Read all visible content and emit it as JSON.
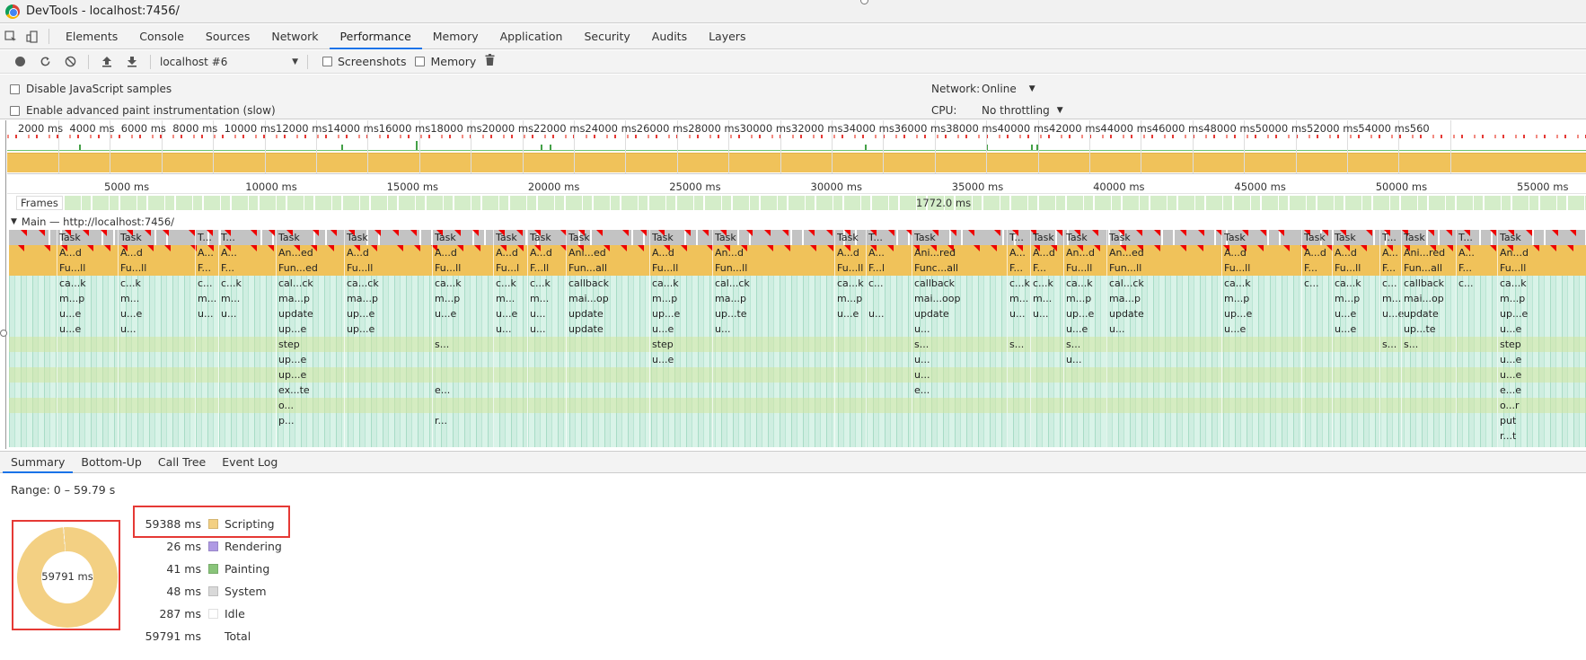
{
  "window": {
    "title": "DevTools - localhost:7456/"
  },
  "tabs": [
    "Elements",
    "Console",
    "Sources",
    "Network",
    "Performance",
    "Memory",
    "Application",
    "Security",
    "Audits",
    "Layers"
  ],
  "active_tab": "Performance",
  "toolbar": {
    "profile_select": "localhost #6",
    "screenshots_label": "Screenshots",
    "memory_label": "Memory"
  },
  "settings": {
    "disable_js_samples": "Disable JavaScript samples",
    "advanced_paint": "Enable advanced paint instrumentation (slow)",
    "network_label": "Network:",
    "network_value": "Online",
    "cpu_label": "CPU:",
    "cpu_value": "No throttling"
  },
  "overview_ticks": [
    "2000 ms",
    "4000 ms",
    "6000 ms",
    "8000 ms",
    "10000 ms",
    "12000 ms",
    "14000 ms",
    "16000 ms",
    "18000 ms",
    "20000 ms",
    "22000 ms",
    "24000 ms",
    "26000 ms",
    "28000 ms",
    "30000 ms",
    "32000 ms",
    "34000 ms",
    "36000 ms",
    "38000 ms",
    "40000 ms",
    "42000 ms",
    "44000 ms",
    "46000 ms",
    "48000 ms",
    "50000 ms",
    "52000 ms",
    "54000 ms",
    "560"
  ],
  "ruler_ticks": [
    "5000 ms",
    "10000 ms",
    "15000 ms",
    "20000 ms",
    "25000 ms",
    "30000 ms",
    "35000 ms",
    "40000 ms",
    "45000 ms",
    "50000 ms",
    "55000 ms"
  ],
  "frames": {
    "label": "Frames",
    "value": "1772.0 ms"
  },
  "main_thread": {
    "label": "Main — http://localhost:7456/"
  },
  "flame_columns": [
    {
      "rows": [
        "Task",
        "A...d",
        "Fu...ll",
        "ca...k",
        "m...p",
        "u...e",
        "u...e"
      ]
    },
    {
      "rows": [
        "Task",
        "A...d",
        "Fu...ll",
        "c...k",
        "m...",
        "u...e",
        "u..."
      ]
    },
    {
      "rows": [
        "T...",
        "A...",
        "F...",
        "c...",
        "m...",
        "u...",
        ""
      ]
    },
    {
      "rows": [
        "T...",
        "A...",
        "F...",
        "c...k",
        "m...",
        "u...",
        ""
      ]
    },
    {
      "rows": [
        "Task",
        "An...ed",
        "Fun...ed",
        "cal...ck",
        "ma...p",
        "update",
        "up...e",
        "step",
        "up...e",
        "up...e",
        "ex...te",
        "o...",
        "p..."
      ]
    },
    {
      "rows": [
        "Task",
        "A...d",
        "Fu...ll",
        "ca...ck",
        "ma...p",
        "up...e",
        "up...e"
      ]
    },
    {
      "rows": [
        "Task",
        "A...d",
        "Fu...ll",
        "ca...k",
        "m...p",
        "u...e",
        "",
        "s...",
        "",
        "",
        "e...",
        "",
        "r..."
      ]
    },
    {
      "rows": [
        "Task",
        "A...d",
        "Fu...l",
        "c...k",
        "m...",
        "u...e",
        "u..."
      ]
    },
    {
      "rows": [
        "Task",
        "A...d",
        "F...ll",
        "c...k",
        "m...",
        "u...",
        "u..."
      ]
    },
    {
      "rows": [
        "Task",
        "Ani...ed",
        "Fun...all",
        "callback",
        "mai...op",
        "update",
        "update"
      ]
    },
    {
      "rows": [
        "Task",
        "A...d",
        "Fu...ll",
        "ca...k",
        "m...p",
        "up...e",
        "u...e",
        "step",
        "u...e"
      ]
    },
    {
      "rows": [
        "Task",
        "An...d",
        "Fun...ll",
        "cal...ck",
        "ma...p",
        "up...te",
        "u..."
      ]
    },
    {
      "rows": [
        "Task",
        "A...d",
        "Fu...ll",
        "ca...k",
        "m...p",
        "u...e"
      ]
    },
    {
      "rows": [
        "T...",
        "A...",
        "F...l",
        "c...",
        "",
        "u..."
      ]
    },
    {
      "rows": [
        "Task",
        "Ani...red",
        "Func...all",
        "callback",
        "mai...oop",
        "update",
        "u...",
        "s...",
        "u...",
        "u...",
        "e..."
      ]
    },
    {
      "rows": [
        "T...",
        "A...",
        "F...",
        "c...k",
        "m...",
        "u...",
        "",
        "s..."
      ]
    },
    {
      "rows": [
        "Task",
        "A...d",
        "F...",
        "c...k",
        "m...",
        "u..."
      ]
    },
    {
      "rows": [
        "Task",
        "An...d",
        "Fu...ll",
        "ca...k",
        "m...p",
        "up...e",
        "u...e",
        "s...",
        "u..."
      ]
    },
    {
      "rows": [
        "Task",
        "An...ed",
        "Fun...ll",
        "cal...ck",
        "ma...p",
        "update",
        "u..."
      ]
    },
    {
      "rows": [
        "Task",
        "A...d",
        "Fu...ll",
        "ca...k",
        "m...p",
        "up...e",
        "u...e"
      ]
    },
    {
      "rows": [
        "Task",
        "A...d",
        "F...",
        "c...",
        "",
        "",
        ""
      ]
    },
    {
      "rows": [
        "Task",
        "A...d",
        "Fu...ll",
        "ca...k",
        "m...p",
        "u...e",
        "u...e"
      ]
    },
    {
      "rows": [
        "T...",
        "A...",
        "F...",
        "c...",
        "m...",
        "u...e",
        "",
        "s..."
      ]
    },
    {
      "rows": [
        "Task",
        "Ani...red",
        "Fun...all",
        "callback",
        "mai...op",
        "update",
        "up...te",
        "s..."
      ]
    },
    {
      "rows": [
        "T...",
        "A...",
        "F...",
        "c...",
        "",
        "",
        ""
      ]
    },
    {
      "rows": [
        "Task",
        "An...d",
        "Fu...ll",
        "ca...k",
        "m...p",
        "up...e",
        "u...e",
        "step",
        "u...e",
        "u...e",
        "e...e",
        "o...r",
        "put",
        "r...t"
      ]
    }
  ],
  "bottom_tabs": [
    "Summary",
    "Bottom-Up",
    "Call Tree",
    "Event Log"
  ],
  "active_bottom_tab": "Summary",
  "summary": {
    "range": "Range: 0 – 59.79 s",
    "total_label": "59791 ms",
    "items": [
      {
        "value": "59388 ms",
        "name": "Scripting",
        "color": "#f3d083"
      },
      {
        "value": "26 ms",
        "name": "Rendering",
        "color": "#af9ae4"
      },
      {
        "value": "41 ms",
        "name": "Painting",
        "color": "#89c47a"
      },
      {
        "value": "48 ms",
        "name": "System",
        "color": "#d9d9d9"
      },
      {
        "value": "287 ms",
        "name": "Idle",
        "color": "#ffffff"
      }
    ],
    "total": {
      "value": "59791 ms",
      "name": "Total"
    }
  },
  "chart_data": {
    "type": "pie",
    "title": "",
    "categories": [
      "Scripting",
      "Rendering",
      "Painting",
      "System",
      "Idle"
    ],
    "values": [
      59388,
      26,
      41,
      48,
      287
    ],
    "unit": "ms"
  }
}
